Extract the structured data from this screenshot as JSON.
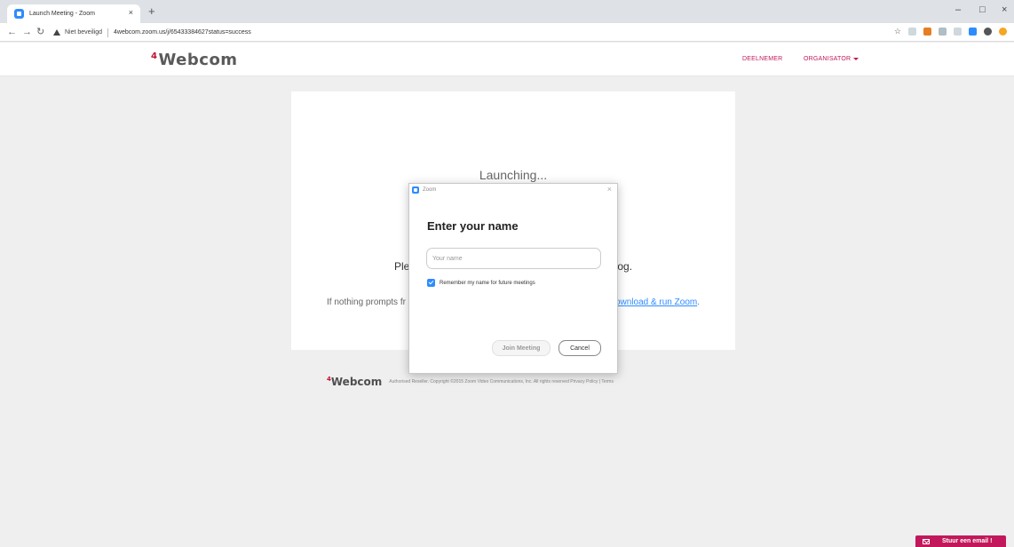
{
  "browser": {
    "tab_title": "Launch Meeting - Zoom",
    "tab_close": "×",
    "new_tab": "+",
    "security_label": "Niet beveiligd",
    "url": "4webcom.zoom.us/j/65433384627status=success",
    "window_controls": {
      "minimize": "–",
      "maximize": "□",
      "close": "×"
    }
  },
  "header": {
    "logo_superscript": "4",
    "logo_text": "Webcom",
    "nav": {
      "participant": "DEELNEMER",
      "organizer": "ORGANISATOR"
    }
  },
  "launch": {
    "status": "Launching...",
    "prompt_left": "Please click",
    "prompt_right": "tem dialog.",
    "fallback_left": "If nothing prompts fr",
    "fallback_link": "ownload & run Zoom",
    "fallback_end": "."
  },
  "dialog": {
    "titlebar_title": "Zoom",
    "close": "×",
    "heading": "Enter your name",
    "name_value": "",
    "name_placeholder": "Your name",
    "remember_label": "Remember my name for future meetings",
    "remember_checked": true,
    "join_label": "Join Meeting",
    "cancel_label": "Cancel"
  },
  "footer": {
    "logo_superscript": "4",
    "logo_text": "Webcom",
    "text": "Authorised Reseller. Copyright ©2015 Zoom Video Communications, Inc. All rights reserved Privacy Policy | Terms"
  },
  "email_widget": {
    "label": "Stuur een email !"
  },
  "colors": {
    "accent": "#c2185b",
    "zoom_blue": "#2d8cff",
    "page_bg": "#efefef"
  }
}
